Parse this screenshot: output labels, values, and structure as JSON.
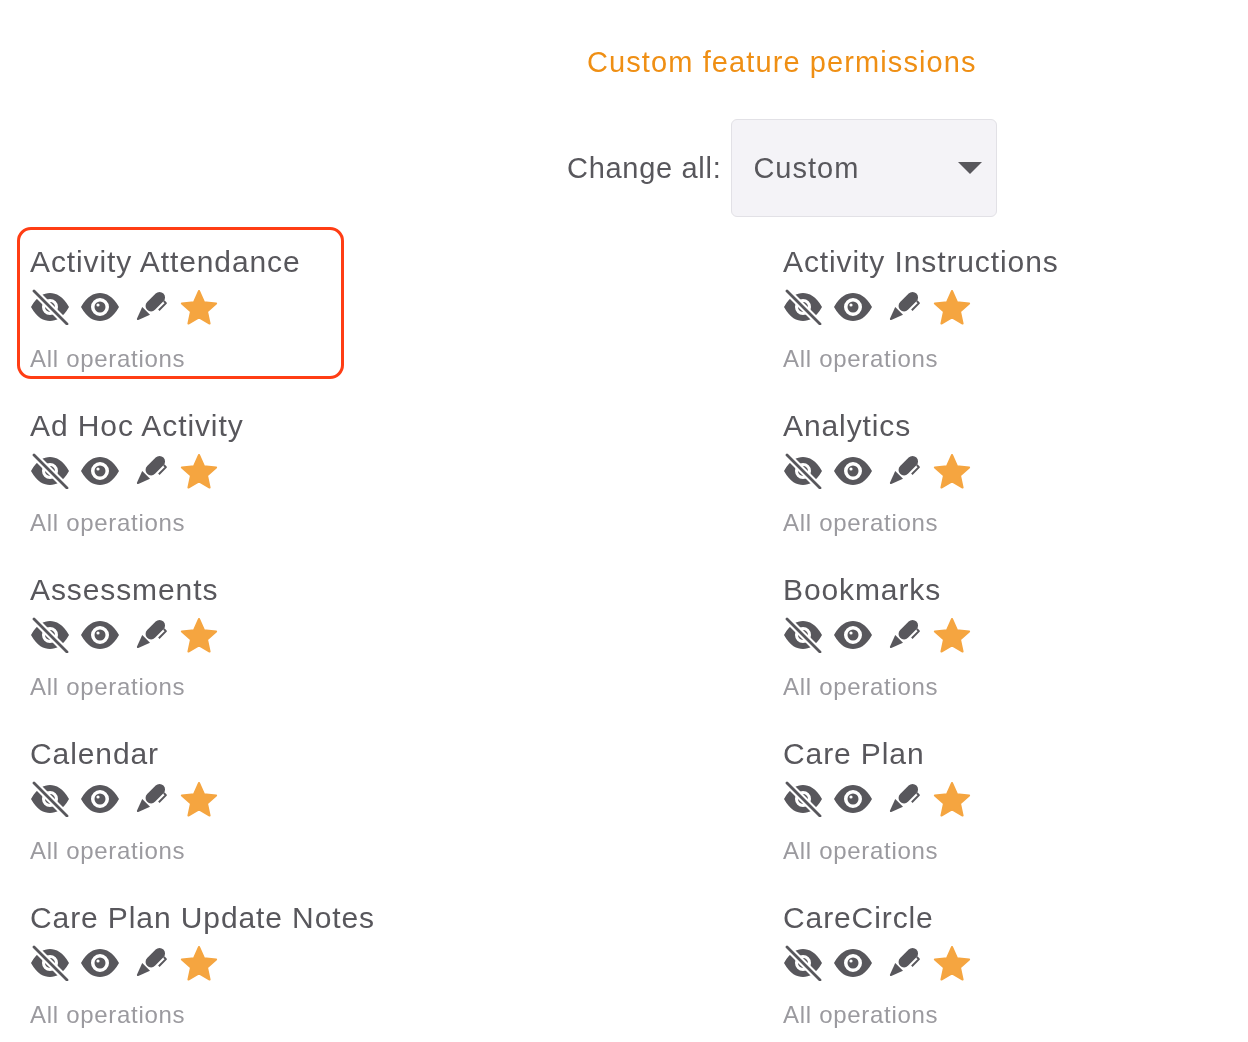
{
  "title": "Custom feature permissions",
  "change_all": {
    "label": "Change all:",
    "value": "Custom"
  },
  "features": [
    {
      "name": "Activity Attendance",
      "highlighted": true,
      "permissions": [
        {
          "kind": "hidden",
          "selected": false
        },
        {
          "kind": "view",
          "selected": false
        },
        {
          "kind": "edit",
          "selected": false
        },
        {
          "kind": "all",
          "selected": true
        }
      ],
      "summary": "All operations"
    },
    {
      "name": "Activity Instructions",
      "highlighted": false,
      "permissions": [
        {
          "kind": "hidden",
          "selected": false
        },
        {
          "kind": "view",
          "selected": false
        },
        {
          "kind": "edit",
          "selected": false
        },
        {
          "kind": "all",
          "selected": true
        }
      ],
      "summary": "All operations"
    },
    {
      "name": "Ad Hoc Activity",
      "highlighted": false,
      "permissions": [
        {
          "kind": "hidden",
          "selected": false
        },
        {
          "kind": "view",
          "selected": false
        },
        {
          "kind": "edit",
          "selected": false
        },
        {
          "kind": "all",
          "selected": true
        }
      ],
      "summary": "All operations"
    },
    {
      "name": "Analytics",
      "highlighted": false,
      "permissions": [
        {
          "kind": "hidden",
          "selected": false
        },
        {
          "kind": "view",
          "selected": false
        },
        {
          "kind": "edit",
          "selected": false
        },
        {
          "kind": "all",
          "selected": true
        }
      ],
      "summary": "All operations"
    },
    {
      "name": "Assessments",
      "highlighted": false,
      "permissions": [
        {
          "kind": "hidden",
          "selected": false
        },
        {
          "kind": "view",
          "selected": false
        },
        {
          "kind": "edit",
          "selected": false
        },
        {
          "kind": "all",
          "selected": true
        }
      ],
      "summary": "All operations"
    },
    {
      "name": "Bookmarks",
      "highlighted": false,
      "permissions": [
        {
          "kind": "hidden",
          "selected": false
        },
        {
          "kind": "view",
          "selected": false
        },
        {
          "kind": "edit",
          "selected": false
        },
        {
          "kind": "all",
          "selected": true
        }
      ],
      "summary": "All operations"
    },
    {
      "name": "Calendar",
      "highlighted": false,
      "permissions": [
        {
          "kind": "hidden",
          "selected": false
        },
        {
          "kind": "view",
          "selected": false
        },
        {
          "kind": "edit",
          "selected": false
        },
        {
          "kind": "all",
          "selected": true
        }
      ],
      "summary": "All operations"
    },
    {
      "name": "Care Plan",
      "highlighted": false,
      "permissions": [
        {
          "kind": "hidden",
          "selected": false
        },
        {
          "kind": "view",
          "selected": false
        },
        {
          "kind": "edit",
          "selected": false
        },
        {
          "kind": "all",
          "selected": true
        }
      ],
      "summary": "All operations"
    },
    {
      "name": "Care Plan Update Notes",
      "highlighted": false,
      "permissions": [
        {
          "kind": "hidden",
          "selected": false
        },
        {
          "kind": "view",
          "selected": false
        },
        {
          "kind": "edit",
          "selected": false
        },
        {
          "kind": "all",
          "selected": true
        }
      ],
      "summary": "All operations"
    },
    {
      "name": "CareCircle",
      "highlighted": false,
      "permissions": [
        {
          "kind": "hidden",
          "selected": false
        },
        {
          "kind": "view",
          "selected": false
        },
        {
          "kind": "edit",
          "selected": false
        },
        {
          "kind": "all",
          "selected": true
        }
      ],
      "summary": "All operations"
    }
  ]
}
